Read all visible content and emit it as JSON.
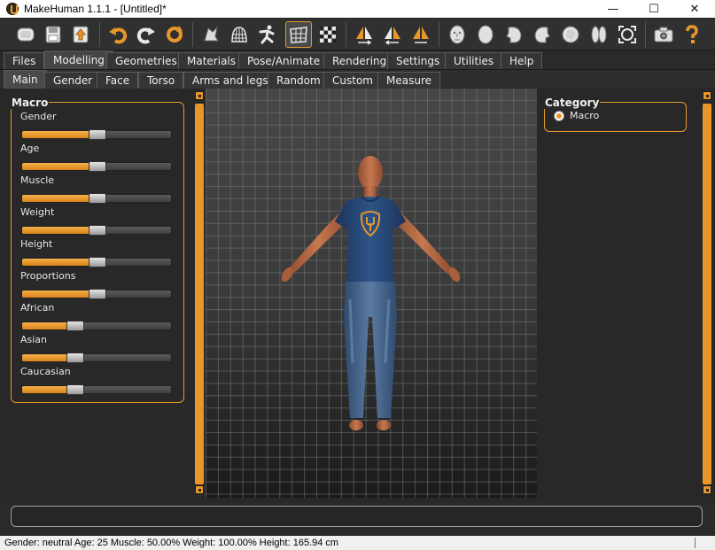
{
  "window": {
    "title": "MakeHuman 1.1.1 - [Untitled]*",
    "minimize_glyph": "—",
    "maximize_glyph": "☐",
    "close_glyph": "✕"
  },
  "toolbar": {
    "icons": [
      "new-file-icon",
      "save-icon",
      "export-icon",
      "undo-icon",
      "redo-icon",
      "reset-icon",
      "smooth-icon",
      "wireframe-icon",
      "pose-icon",
      "grid-icon",
      "checker-icon",
      "symmetry-right-icon",
      "symmetry-left-icon",
      "symmetry-icon",
      "face-front-icon",
      "head-icon",
      "face-left-icon",
      "face-right-icon",
      "head-top-icon",
      "head-back-icon",
      "reset-camera-icon",
      "screenshot-icon",
      "help-icon"
    ]
  },
  "main_tabs": [
    "Files",
    "Modelling",
    "Geometries",
    "Materials",
    "Pose/Animate",
    "Rendering",
    "Settings",
    "Utilities",
    "Help"
  ],
  "main_tab_active": "Modelling",
  "sub_tabs": [
    "Main",
    "Gender",
    "Face",
    "Torso",
    "Arms and legs",
    "Random",
    "Custom",
    "Measure"
  ],
  "sub_tab_active": "Main",
  "macro": {
    "title": "Macro",
    "sliders": [
      {
        "label": "Gender",
        "value": 0.5
      },
      {
        "label": "Age",
        "value": 0.5
      },
      {
        "label": "Muscle",
        "value": 0.5
      },
      {
        "label": "Weight",
        "value": 0.5
      },
      {
        "label": "Height",
        "value": 0.5
      },
      {
        "label": "Proportions",
        "value": 0.5
      },
      {
        "label": "African",
        "value": 0.333
      },
      {
        "label": "Asian",
        "value": 0.333
      },
      {
        "label": "Caucasian",
        "value": 0.333
      }
    ]
  },
  "category": {
    "title": "Category",
    "option": "Macro"
  },
  "status": {
    "text": "Gender: neutral Age: 25 Muscle: 50.00% Weight: 100.00% Height: 165.94 cm"
  },
  "colors": {
    "accent": "#e8962a",
    "background": "#282828",
    "shirt": "#23416e",
    "jeans": "#3f5f85",
    "skin": "#b96a47"
  }
}
